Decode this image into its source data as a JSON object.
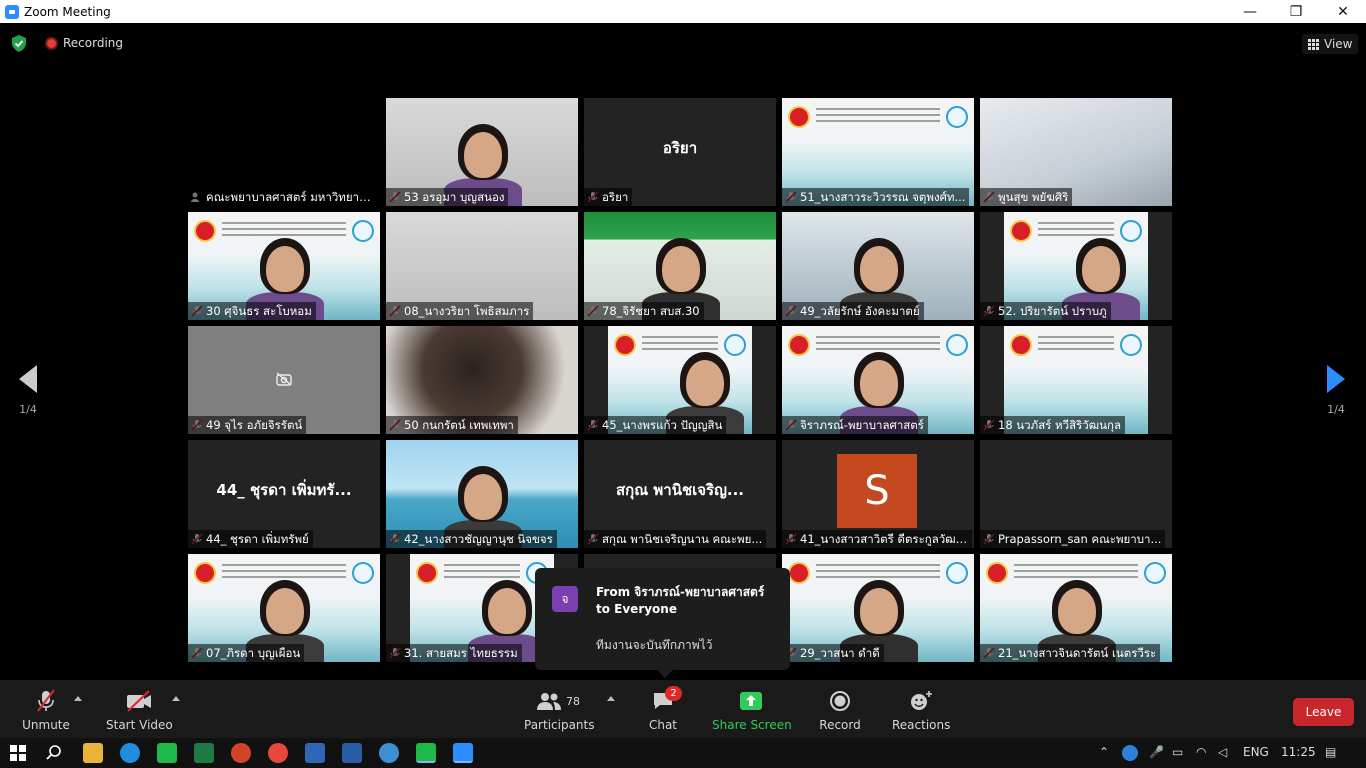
{
  "window": {
    "title": "Zoom Meeting",
    "min": "—",
    "max": "❐",
    "close": "✕"
  },
  "top": {
    "recording_label": "Recording",
    "view_label": "View"
  },
  "nav": {
    "left_page": "1/4",
    "right_page": "1/4"
  },
  "tiles": [
    {
      "name": "คณะพยาบาลศาสตร์ มหาวิทยาลั...",
      "big": ""
    },
    {
      "name": "53 อรอุมา บุญสนอง",
      "big": ""
    },
    {
      "name": "อริยา",
      "big": "อริยา"
    },
    {
      "name": "51_นางสาวระวิวรรณ จตุพงศ์ท...",
      "big": ""
    },
    {
      "name": "พูนสุข พยัฆศิริ",
      "big": ""
    },
    {
      "name": "30 ศุจินธร สะโบหอม",
      "big": ""
    },
    {
      "name": "08_นางวริยา โพธิสมภาร",
      "big": ""
    },
    {
      "name": "78_จิรัชยา สบส.30",
      "big": ""
    },
    {
      "name": "49_วลัยรักษ์ อังคะมาตย์",
      "big": ""
    },
    {
      "name": "52. ปริยารัตน์ ปราบภู",
      "big": ""
    },
    {
      "name": "49 จุไร อภัยจิรรัตน์",
      "big": ""
    },
    {
      "name": "50 กนกรัตน์ เทพเทพา",
      "big": ""
    },
    {
      "name": "45_นางพรแก้ว ปัญญสิน",
      "big": ""
    },
    {
      "name": "จิราภรณ์-พยาบาลศาสตร์",
      "big": ""
    },
    {
      "name": "18 นวภัสร์ หวีสิริวัฒนกุล",
      "big": ""
    },
    {
      "name": "44_ ชุรดา เพิ่มทรัพย์",
      "big": "44_ ชุรดา เพิ่มทรั..."
    },
    {
      "name": "42_นางสาวชัญญานุช นิจขจร",
      "big": ""
    },
    {
      "name": "สกุณ พานิชเจริญนาน คณะพย...",
      "big": "สกุณ พานิชเจริญ..."
    },
    {
      "name": "41_นางสาวสาวิตรี ดีตระกูลวัฒน...",
      "big": "",
      "avatar": "S"
    },
    {
      "name": "Prapassorn_san คณะพยาบา...",
      "big": ""
    },
    {
      "name": "07_ภิรดา บุญเผือน",
      "big": ""
    },
    {
      "name": "31. สายสมร ไทยธรรม",
      "big": ""
    },
    {
      "name": "",
      "big": ""
    },
    {
      "name": "29_วาสนา ดำดี",
      "big": ""
    },
    {
      "name": "21_นางสาวจินดารัตน์ เนตรวีระ",
      "big": ""
    }
  ],
  "chat_popup": {
    "avatar": "จ",
    "from": "From จิราภรณ์-พยาบาลศาสตร์ to Everyone",
    "message": "ทีมงานจะบันทึกภาพไว้"
  },
  "toolbar": {
    "unmute": "Unmute",
    "start_video": "Start Video",
    "participants": "Participants",
    "participants_count": "78",
    "chat": "Chat",
    "chat_badge": "2",
    "share_screen": "Share Screen",
    "record": "Record",
    "reactions": "Reactions",
    "leave": "Leave"
  },
  "taskbar": {
    "lang": "ENG",
    "time": "11:25"
  },
  "colors": {
    "accent": "#2d8cff",
    "share": "#2fcc5a",
    "leave": "#c7262b",
    "active_speaker": "#c2e34a"
  }
}
